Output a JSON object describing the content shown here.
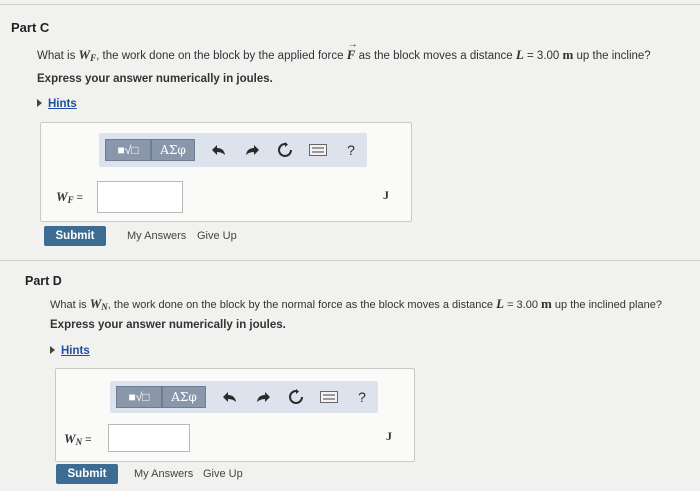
{
  "partC": {
    "title": "Part C",
    "q_pre": "What is ",
    "q_var": "W",
    "q_var_sub": "F",
    "q_mid": ", the work done on the block by the applied force ",
    "q_force": "F",
    "q_post": " as the block moves a distance ",
    "q_dist_var": "L",
    "q_eq": " = 3.00 ",
    "q_unit": "m",
    "q_end": " up the incline?",
    "instruction": "Express your answer numerically in joules.",
    "hints": "Hints",
    "toolbar": {
      "templates": "■√□",
      "greek": "ΑΣφ",
      "help": "?"
    },
    "answer_label_var": "W",
    "answer_label_sub": "F",
    "answer_label_eq": " =",
    "answer_value": "",
    "unit": "J",
    "submit": "Submit",
    "my_answers": "My Answers",
    "give_up": "Give Up"
  },
  "partD": {
    "title": "Part D",
    "q_pre": "What is ",
    "q_var": "W",
    "q_var_sub": "N",
    "q_mid": ", the work done on the block by the normal force as the block moves a distance ",
    "q_dist_var": "L",
    "q_eq": " = 3.00 ",
    "q_unit": "m",
    "q_end": " up the inclined plane?",
    "instruction": "Express your answer numerically in joules.",
    "hints": "Hints",
    "toolbar": {
      "templates": "■√□",
      "greek": "ΑΣφ",
      "help": "?"
    },
    "answer_label_var": "W",
    "answer_label_sub": "N",
    "answer_label_eq": " =",
    "answer_value": "",
    "unit": "J",
    "submit": "Submit",
    "my_answers": "My Answers",
    "give_up": "Give Up"
  },
  "icons": [
    "templates-icon",
    "greek-icon",
    "undo-icon",
    "redo-icon",
    "reset-icon",
    "keyboard-icon",
    "help-icon"
  ],
  "colors": {
    "submit": "#3c6c91",
    "toolbar": "#dde3ec",
    "toolbar_button": "#8a97ab",
    "link": "#1f4fa0"
  }
}
